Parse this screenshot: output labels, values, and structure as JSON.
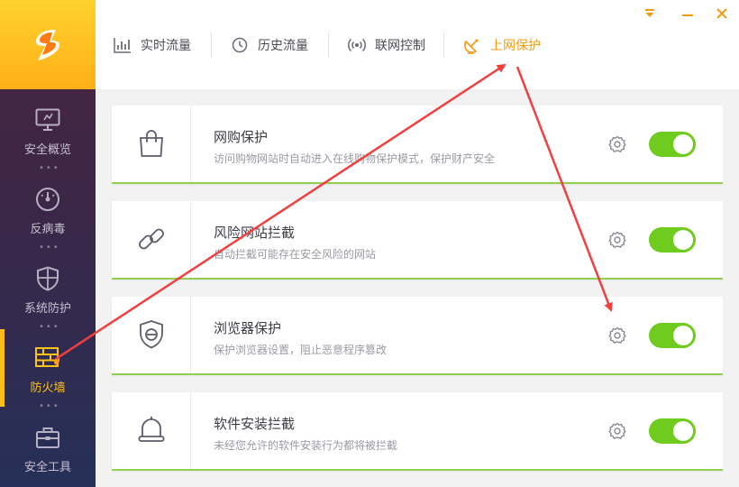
{
  "sidebar": {
    "items": [
      {
        "label": "安全概览",
        "icon": "monitor-icon",
        "active": false
      },
      {
        "label": "反病毒",
        "icon": "gauge-icon",
        "active": false
      },
      {
        "label": "系统防护",
        "icon": "shield-icon",
        "active": false
      },
      {
        "label": "防火墙",
        "icon": "firewall-icon",
        "active": true
      },
      {
        "label": "安全工具",
        "icon": "toolbox-icon",
        "active": false
      }
    ],
    "dots": "•••"
  },
  "tabs": [
    {
      "label": "实时流量",
      "icon": "bar-chart-icon"
    },
    {
      "label": "历史流量",
      "icon": "clock-icon"
    },
    {
      "label": "联网控制",
      "icon": "signal-icon"
    },
    {
      "label": "上网保护",
      "icon": "satellite-dish-icon",
      "active": true
    }
  ],
  "cards": [
    {
      "title": "网购保护",
      "desc": "访问购物网站时自动进入在线购物保护模式，保护财产安全",
      "icon": "shopping-bag-icon",
      "enabled": true
    },
    {
      "title": "风险网站拦截",
      "desc": "自动拦截可能存在安全风险的网站",
      "icon": "link-icon",
      "enabled": true
    },
    {
      "title": "浏览器保护",
      "desc": "保护浏览器设置，阻止恶意程序篡改",
      "icon": "browser-shield-icon",
      "enabled": true
    },
    {
      "title": "软件安装拦截",
      "desc": "未经您允许的软件安装行为都将被拦截",
      "icon": "bell-icon",
      "enabled": true
    }
  ],
  "colors": {
    "accent": "#f39a10",
    "toggle_on": "#6fcc1e",
    "card_underline": "#8fd14f",
    "annotation_arrow": "#f04040"
  }
}
